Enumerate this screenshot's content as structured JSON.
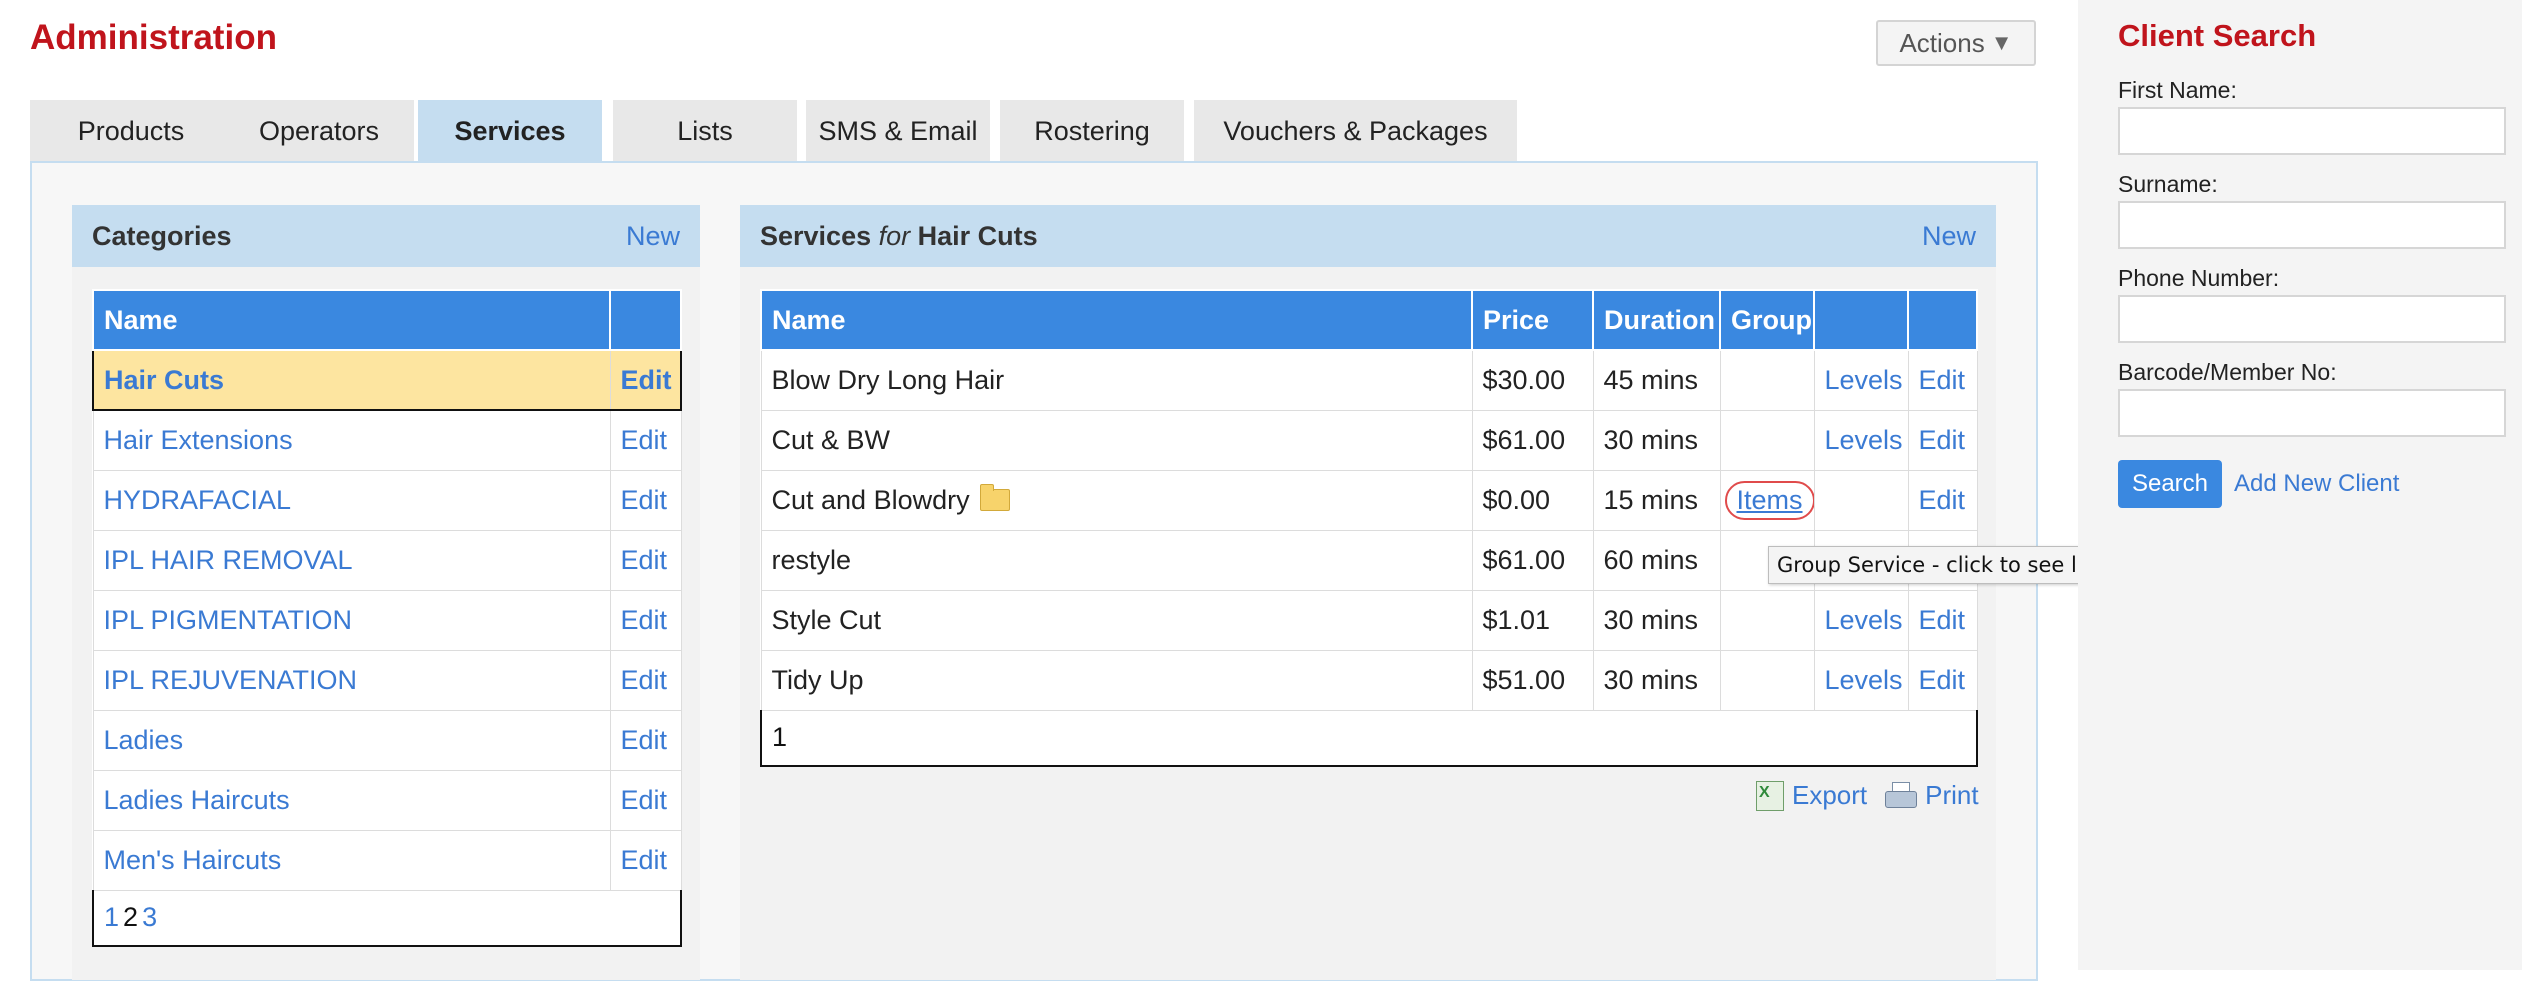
{
  "header": {
    "title": "Administration",
    "actions_label": "Actions",
    "actions_arrow": "▼"
  },
  "tabs": [
    {
      "label": "Products"
    },
    {
      "label": "Operators"
    },
    {
      "label": "Services",
      "active": true
    },
    {
      "label": "Lists"
    },
    {
      "label": "SMS & Email"
    },
    {
      "label": "Rostering"
    },
    {
      "label": "Vouchers & Packages"
    }
  ],
  "categories": {
    "title": "Categories",
    "new_label": "New",
    "columns": [
      "Name",
      ""
    ],
    "rows": [
      {
        "name": "Hair Cuts",
        "action": "Edit",
        "selected": true
      },
      {
        "name": "Hair Extensions",
        "action": "Edit"
      },
      {
        "name": "HYDRAFACIAL",
        "action": "Edit"
      },
      {
        "name": "IPL HAIR REMOVAL",
        "action": "Edit"
      },
      {
        "name": "IPL PIGMENTATION",
        "action": "Edit"
      },
      {
        "name": "IPL REJUVENATION",
        "action": "Edit"
      },
      {
        "name": "Ladies",
        "action": "Edit"
      },
      {
        "name": "Ladies Haircuts",
        "action": "Edit"
      },
      {
        "name": "Men's Haircuts",
        "action": "Edit"
      }
    ],
    "pages": [
      "1",
      "2",
      "3"
    ],
    "current_page": "2"
  },
  "services": {
    "title_prefix": "Services",
    "title_for": "for",
    "title_category": "Hair Cuts",
    "new_label": "New",
    "columns": [
      "Name",
      "Price",
      "Duration",
      "Group",
      "",
      ""
    ],
    "rows": [
      {
        "name": "Blow Dry Long Hair",
        "price": "$30.00",
        "duration": "45 mins",
        "group": "",
        "levels": "Levels",
        "edit": "Edit"
      },
      {
        "name": "Cut & BW",
        "price": "$61.00",
        "duration": "30 mins",
        "group": "",
        "levels": "Levels",
        "edit": "Edit"
      },
      {
        "name": "Cut and Blowdry",
        "price": "$0.00",
        "duration": "15 mins",
        "group": "Items",
        "levels": "",
        "edit": "Edit",
        "folder": true
      },
      {
        "name": "restyle",
        "price": "$61.00",
        "duration": "60 mins",
        "group": "",
        "levels": "",
        "edit": ""
      },
      {
        "name": "Style Cut",
        "price": "$1.01",
        "duration": "30 mins",
        "group": "",
        "levels": "Levels",
        "edit": "Edit"
      },
      {
        "name": "Tidy Up",
        "price": "$51.00",
        "duration": "30 mins",
        "group": "",
        "levels": "Levels",
        "edit": "Edit"
      }
    ],
    "pages": [
      "1"
    ],
    "export_label": "Export",
    "print_label": "Print",
    "tooltip": "Group Service - click to see list of grouped items"
  },
  "client_search": {
    "title": "Client Search",
    "first_name_label": "First Name:",
    "first_name_value": "",
    "surname_label": "Surname:",
    "surname_value": "",
    "phone_label": "Phone Number:",
    "phone_value": "",
    "barcode_label": "Barcode/Member No:",
    "barcode_value": "",
    "search_label": "Search",
    "add_client_label": "Add New Client"
  },
  "colors": {
    "brand_red": "#c0141c",
    "header_blue": "#3a88e0",
    "panel_blue": "#c5ddf0",
    "link_blue": "#3a7ad3",
    "selected_row": "#fde5a0"
  }
}
